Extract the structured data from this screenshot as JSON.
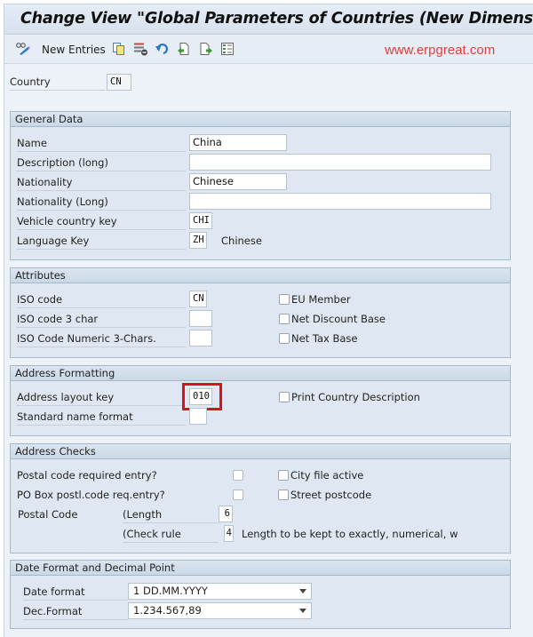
{
  "window": {
    "title": "Change View \"Global Parameters of Countries (New Dimension Syst"
  },
  "toolbar": {
    "new_entries_label": "New Entries",
    "icons": [
      "display-change-icon",
      "copy-icon",
      "delete-icon",
      "undo-icon",
      "previous-entry-icon",
      "next-entry-icon",
      "select-block-icon"
    ],
    "watermark": "www.erpgreat.com"
  },
  "country": {
    "label": "Country",
    "value": "CN"
  },
  "general_data": {
    "title": "General Data",
    "name_label": "Name",
    "name_value": "China",
    "description_label": "Description (long)",
    "description_value": "",
    "nationality_label": "Nationality",
    "nationality_value": "Chinese",
    "nationality_long_label": "Nationality (Long)",
    "nationality_long_value": "",
    "vehicle_key_label": "Vehicle country key",
    "vehicle_key_value": "CHI",
    "language_key_label": "Language Key",
    "language_key_value": "ZH",
    "language_text": "Chinese"
  },
  "attributes": {
    "title": "Attributes",
    "iso_code_label": "ISO code",
    "iso_code_value": "CN",
    "iso3_label": "ISO code 3 char",
    "iso3_value": "",
    "iso_numeric_label": "ISO Code Numeric 3-Chars.",
    "iso_numeric_value": "",
    "eu_member_label": "EU Member",
    "eu_member_checked": false,
    "net_discount_label": "Net Discount Base",
    "net_discount_checked": false,
    "net_tax_label": "Net Tax Base",
    "net_tax_checked": false
  },
  "address_formatting": {
    "title": "Address Formatting",
    "layout_key_label": "Address layout key",
    "layout_key_value": "010",
    "name_format_label": "Standard name format",
    "name_format_value": "",
    "print_country_label": "Print Country Description",
    "print_country_checked": false,
    "highlight_color": "#d8141a"
  },
  "address_checks": {
    "title": "Address Checks",
    "postal_required_label": "Postal code required entry?",
    "postal_required_checked": false,
    "po_box_label": "PO Box postl.code req.entry?",
    "po_box_checked": false,
    "city_file_label": "City file active",
    "city_file_checked": false,
    "street_postcode_label": "Street postcode",
    "street_postcode_checked": false,
    "postal_code_label": "Postal Code",
    "length_label": "(Length",
    "length_value": "6",
    "check_rule_label": "(Check rule",
    "check_rule_value": "4",
    "check_rule_text": "Length to be kept to exactly, numerical, w"
  },
  "date_decimal": {
    "title": "Date Format and Decimal Point",
    "date_format_label": "Date format",
    "date_format_value": "1 DD.MM.YYYY",
    "dec_format_label": "Dec.Format",
    "dec_format_value": "1.234.567,89"
  }
}
